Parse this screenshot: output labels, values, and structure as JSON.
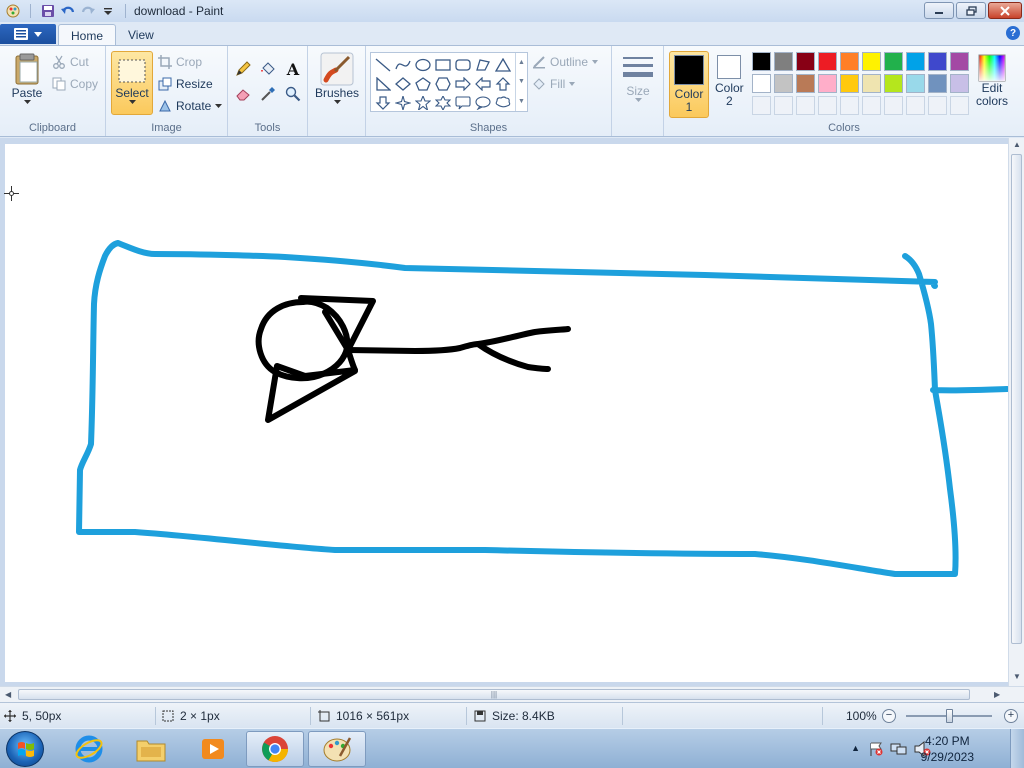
{
  "window": {
    "title": "download - Paint"
  },
  "tabs": {
    "home": "Home",
    "view": "View"
  },
  "clipboard": {
    "label": "Clipboard",
    "paste": "Paste",
    "cut": "Cut",
    "copy": "Copy"
  },
  "image": {
    "label": "Image",
    "select": "Select",
    "crop": "Crop",
    "resize": "Resize",
    "rotate": "Rotate"
  },
  "tools": {
    "label": "Tools",
    "text_tool": "A"
  },
  "brushes": {
    "label": "Brushes"
  },
  "shapes": {
    "label": "Shapes",
    "outline": "Outline",
    "fill": "Fill"
  },
  "size": {
    "label": "Size"
  },
  "colors": {
    "label": "Colors",
    "color1_line1": "Color",
    "color1_line2": "1",
    "color2_line1": "Color",
    "color2_line2": "2",
    "edit_line1": "Edit",
    "edit_line2": "colors",
    "color1_value": "#000000",
    "color2_value": "#ffffff",
    "palette": [
      "#000000",
      "#7f7f7f",
      "#880015",
      "#ed1c24",
      "#ff7f27",
      "#fff200",
      "#22b14c",
      "#00a2e8",
      "#3f48cc",
      "#a349a4",
      "#ffffff",
      "#c3c3c3",
      "#b97a57",
      "#ffaec9",
      "#ffc90e",
      "#efe4b0",
      "#b5e61d",
      "#99d9ea",
      "#7092be",
      "#c8bfe7",
      "",
      "",
      "",
      "",
      "",
      "",
      "",
      "",
      "",
      ""
    ]
  },
  "drawing": {
    "stroke_blue": "#1ea0dc",
    "stroke_black": "#000000"
  },
  "statusbar": {
    "cursor_pos": "5, 50px",
    "selection_size": "2 × 1px",
    "canvas_size": "1016 × 561px",
    "file_size": "Size: 8.4KB",
    "zoom": "100%"
  },
  "taskbar": {
    "time": "4:20 PM",
    "date": "9/29/2023"
  }
}
